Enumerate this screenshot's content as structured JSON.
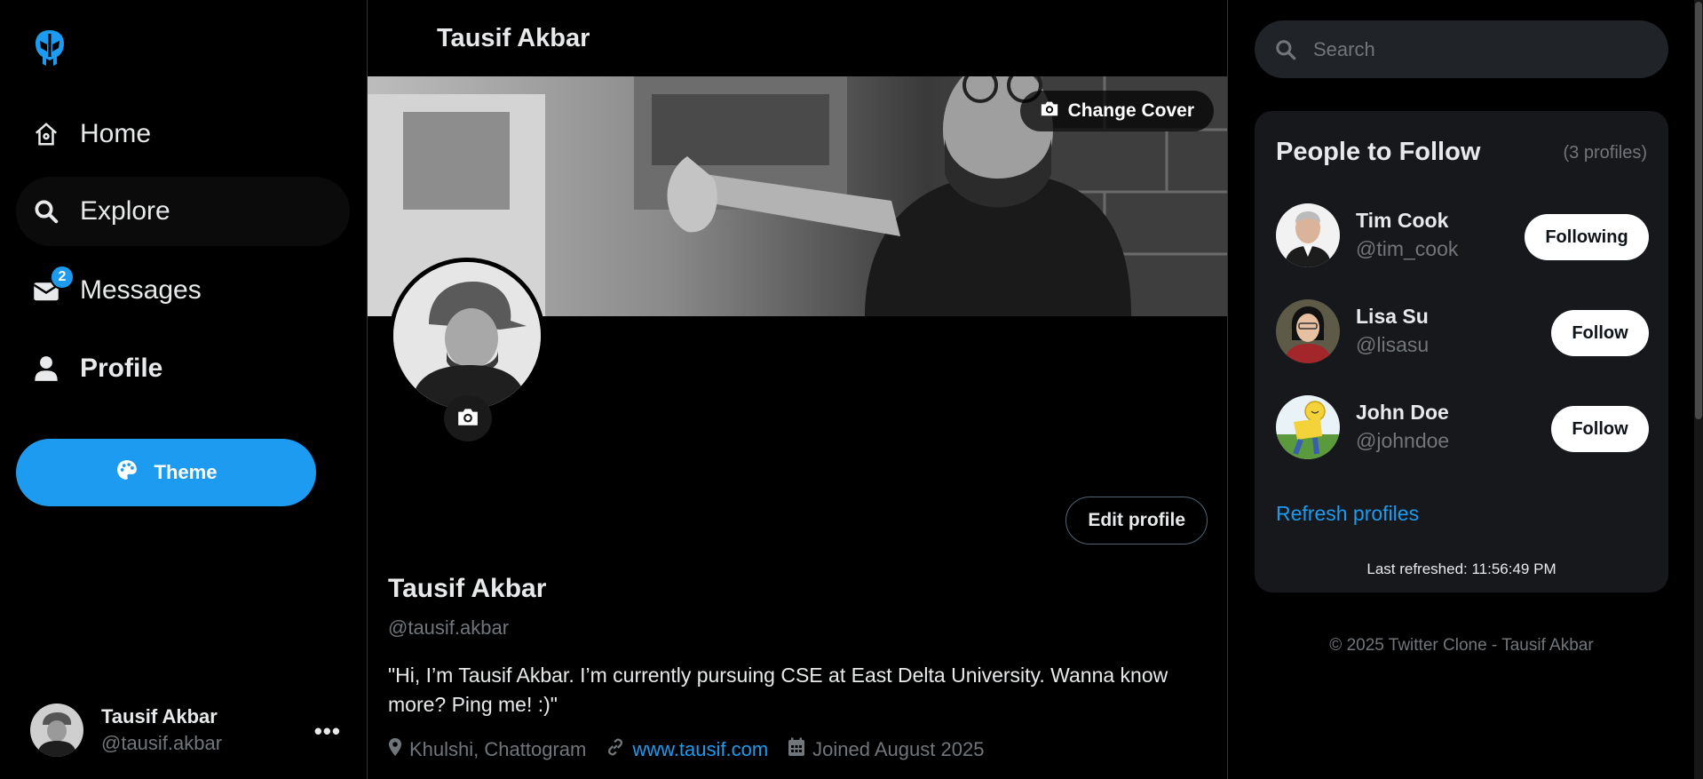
{
  "sidebar": {
    "nav": [
      {
        "label": "Home",
        "icon": "home-icon"
      },
      {
        "label": "Explore",
        "icon": "search-icon"
      },
      {
        "label": "Messages",
        "icon": "envelope-icon",
        "badge": "2"
      },
      {
        "label": "Profile",
        "icon": "user-icon"
      }
    ],
    "theme_label": "Theme",
    "account": {
      "name": "Tausif Akbar",
      "handle": "@tausif.akbar",
      "more": "•••"
    }
  },
  "main": {
    "header_title": "Tausif Akbar",
    "change_cover_label": "Change Cover",
    "edit_profile_label": "Edit profile",
    "profile": {
      "name": "Tausif Akbar",
      "handle": "@tausif.akbar",
      "bio": "\"Hi, I’m Tausif Akbar. I’m currently pursuing CSE at East Delta University. Wanna know more? Ping me! :)\"",
      "location": "Khulshi, Chattogram",
      "website": "www.tausif.com",
      "joined": "Joined August 2025"
    }
  },
  "right": {
    "search": {
      "placeholder": "Search"
    },
    "people_to_follow": {
      "title": "People to Follow",
      "count": "(3 profiles)",
      "people": [
        {
          "name": "Tim Cook",
          "handle": "@tim_cook",
          "button": "Following"
        },
        {
          "name": "Lisa Su",
          "handle": "@lisasu",
          "button": "Follow"
        },
        {
          "name": "John Doe",
          "handle": "@johndoe",
          "button": "Follow"
        }
      ],
      "refresh_label": "Refresh profiles",
      "last_refreshed": "Last refreshed: 11:56:49 PM"
    },
    "footer": "© 2025 Twitter Clone - Tausif Akbar"
  },
  "colors": {
    "accent": "#1d9bf0",
    "background": "#000000",
    "card": "#16181c",
    "muted": "#71767b"
  }
}
